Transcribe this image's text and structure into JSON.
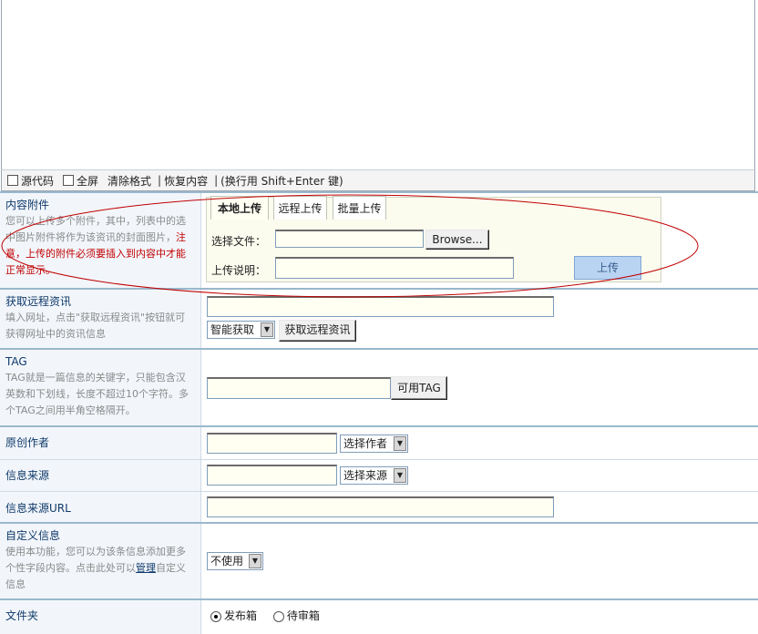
{
  "toolbar": {
    "source_code": "源代码",
    "fullscreen": "全屏",
    "clear_format": "清除格式",
    "separator": "|",
    "restore": "恢复内容",
    "line_hint": "(换行用 Shift+Enter 键)"
  },
  "attachment": {
    "title": "内容附件",
    "desc": "您可以上传多个附件，其中，列表中的选中图片附件将作为该资讯的封面图片，",
    "warning": "注意，上传的附件必须要插入到内容中才能正常显示。",
    "tabs": [
      "本地上传",
      "远程上传",
      "批量上传"
    ],
    "choose_file_label": "选择文件：",
    "browse_button": "Browse...",
    "upload_desc_label": "上传说明：",
    "upload_button": "上传"
  },
  "remote": {
    "title": "获取远程资讯",
    "desc": "填入网址，点击\"获取远程资讯\"按钮就可获得网址中的资讯信息",
    "mode_select": "智能获取",
    "fetch_button": "获取远程资讯"
  },
  "tag": {
    "title": "TAG",
    "desc": "TAG就是一篇信息的关键字，只能包含汉英数和下划线，长度不超过10个字符。多个TAG之间用半角空格隔开。",
    "available_button": "可用TAG"
  },
  "author": {
    "title": "原创作者",
    "select": "选择作者"
  },
  "source": {
    "title": "信息来源",
    "select": "选择来源"
  },
  "source_url": {
    "title": "信息来源URL"
  },
  "custom": {
    "title": "自定义信息",
    "desc_before": "使用本功能，您可以为该条信息添加更多个性字段内容。点击此处可以",
    "manage_link": "管理",
    "desc_after": "自定义信息",
    "select": "不使用"
  },
  "folder": {
    "title": "文件夹",
    "option_publish": "发布箱",
    "option_review": "待审箱",
    "selected": "发布箱"
  },
  "colors": {
    "accent_line": "#9ab8cc",
    "label_bg": "#f2f6fb",
    "title_text": "#103a6a",
    "warning_text": "#c00000",
    "annotation_ellipse": "#c00000"
  }
}
